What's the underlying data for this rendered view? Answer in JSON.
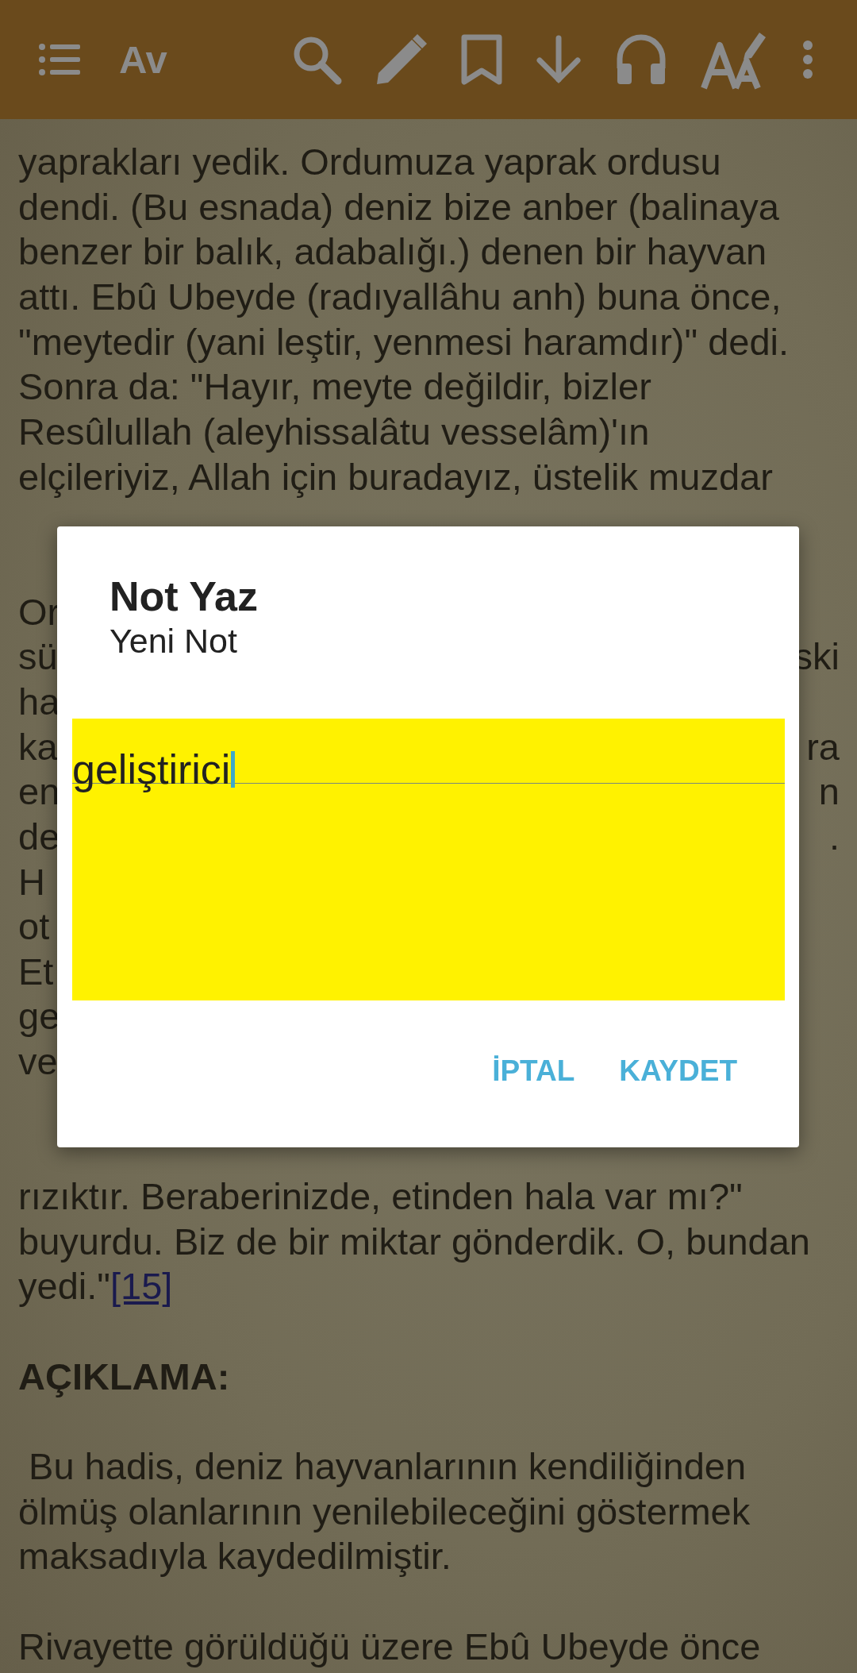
{
  "toolbar": {
    "font_button": "Av"
  },
  "reader": {
    "paragraphs": [
      {
        "kind": "text",
        "lines": [
          {
            "text": "yaprakları yedik. Ordumuza yaprak ordusu"
          },
          {
            "text": "dendi. (Bu esnada) deniz bize anber (balinaya"
          },
          {
            "text": "benzer bir balık, adabalığı.) denen bir hayvan"
          },
          {
            "text": "attı. Ebû Ubeyde (radıyallâhu anh) buna önce,"
          },
          {
            "text": "\"meytedir (yani leştir, yenmesi haramdır)\" dedi."
          },
          {
            "text": "Sonra da: \"Hayır, meyte değildir, bizler"
          },
          {
            "text": "Resûlullah (aleyhissalâtu vesselâm)'ın"
          },
          {
            "text": "elçileriyiz, Allah için buradayız, üstelik muzdar"
          }
        ]
      },
      {
        "kind": "split",
        "lines": [
          {
            "left": "Or"
          },
          {
            "left": "sü",
            "right": "ski"
          },
          {
            "left": "ha"
          },
          {
            "left": "ka",
            "right": "ra"
          },
          {
            "left": "en",
            "right": "n"
          },
          {
            "left": "de",
            "right": "."
          },
          {
            "left": "H"
          },
          {
            "left": "ot"
          },
          {
            "left": "Et"
          },
          {
            "left": "ge"
          },
          {
            "left": "ve"
          }
        ]
      },
      {
        "kind": "text",
        "lines": [
          {
            "text": "rızıktır. Beraberinizde, etinden hala var mı?\""
          },
          {
            "text": "buyurdu. Biz de bir miktar gönderdik. O, bundan"
          },
          {
            "text": "yedi.\"",
            "link": "[15]"
          }
        ]
      },
      {
        "kind": "heading",
        "lines": [
          {
            "text": "AÇIKLAMA:"
          }
        ]
      },
      {
        "kind": "text",
        "lines": [
          {
            "text": " Bu hadis, deniz hayvanlarının kendiliğinden"
          },
          {
            "text": "ölmüş olanlarının yenilebileceğini göstermek"
          },
          {
            "text": "maksadıyla kaydedilmiştir."
          }
        ]
      },
      {
        "kind": "text",
        "lines": [
          {
            "text": "Rivayette görüldüğü üzere Ebû Ubeyde önce"
          }
        ]
      }
    ]
  },
  "dialog": {
    "title": "Not Yaz",
    "subtitle": "Yeni Not",
    "note": {
      "value": "geliştirici",
      "focused": true
    },
    "buttons": [
      "İPTAL",
      "KAYDET"
    ]
  }
}
